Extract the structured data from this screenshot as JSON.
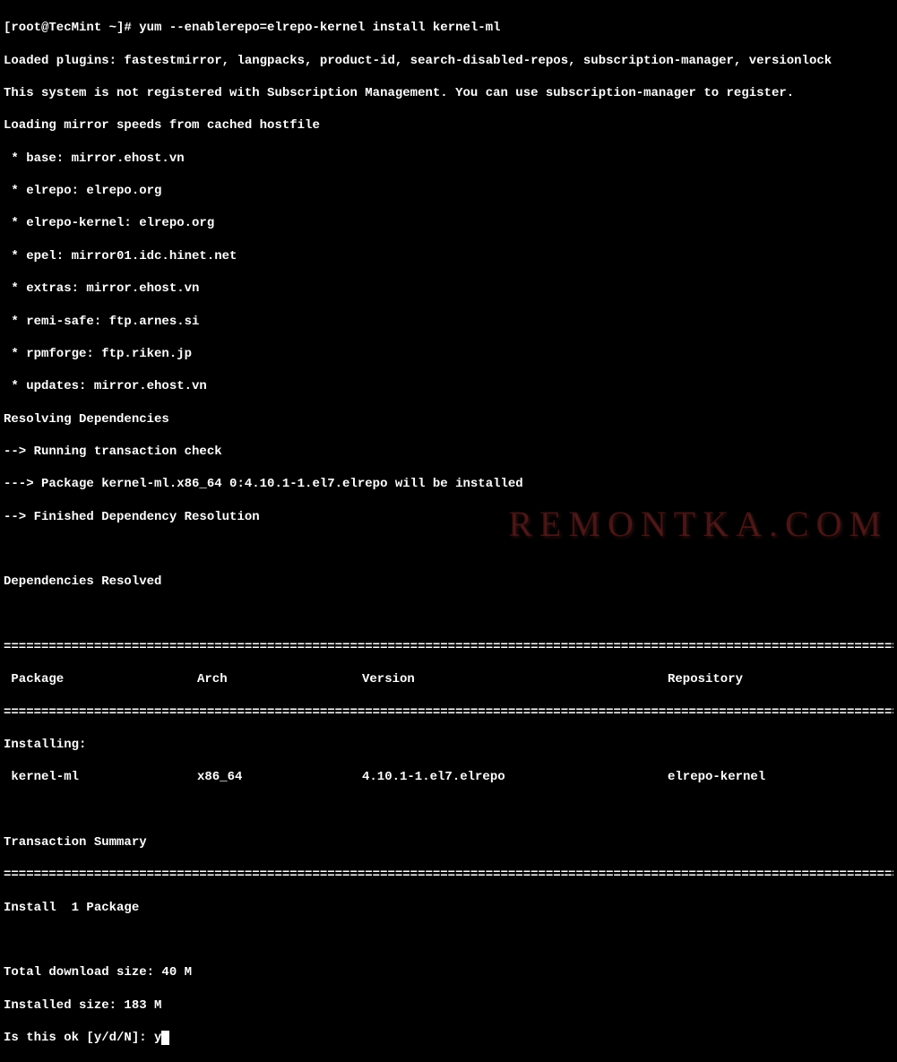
{
  "prompt": "[root@TecMint ~]# ",
  "command": "yum --enablerepo=elrepo-kernel install kernel-ml",
  "output_lines": [
    "Loaded plugins: fastestmirror, langpacks, product-id, search-disabled-repos, subscription-manager, versionlock",
    "This system is not registered with Subscription Management. You can use subscription-manager to register.",
    "Loading mirror speeds from cached hostfile",
    " * base: mirror.ehost.vn",
    " * elrepo: elrepo.org",
    " * elrepo-kernel: elrepo.org",
    " * epel: mirror01.idc.hinet.net",
    " * extras: mirror.ehost.vn",
    " * remi-safe: ftp.arnes.si",
    " * rpmforge: ftp.riken.jp",
    " * updates: mirror.ehost.vn",
    "Resolving Dependencies",
    "--> Running transaction check",
    "---> Package kernel-ml.x86_64 0:4.10.1-1.el7.elrepo will be installed",
    "--> Finished Dependency Resolution",
    "",
    "Dependencies Resolved",
    ""
  ],
  "separator": "===========================================================================================================================",
  "table_headers": {
    "package": " Package",
    "arch": "Arch",
    "version": "Version",
    "repository": "Repository"
  },
  "installing_label": "Installing:",
  "package_row": {
    "package": " kernel-ml",
    "arch": "x86_64",
    "version": "4.10.1-1.el7.elrepo",
    "repository": "elrepo-kernel"
  },
  "transaction_summary": "Transaction Summary",
  "install_summary": "Install  1 Package",
  "download_size": "Total download size: 40 M",
  "installed_size": "Installed size: 183 M",
  "confirm_prompt": "Is this ok [y/d/N]: ",
  "confirm_answer": "y",
  "watermark": "REMONTKA.COM"
}
